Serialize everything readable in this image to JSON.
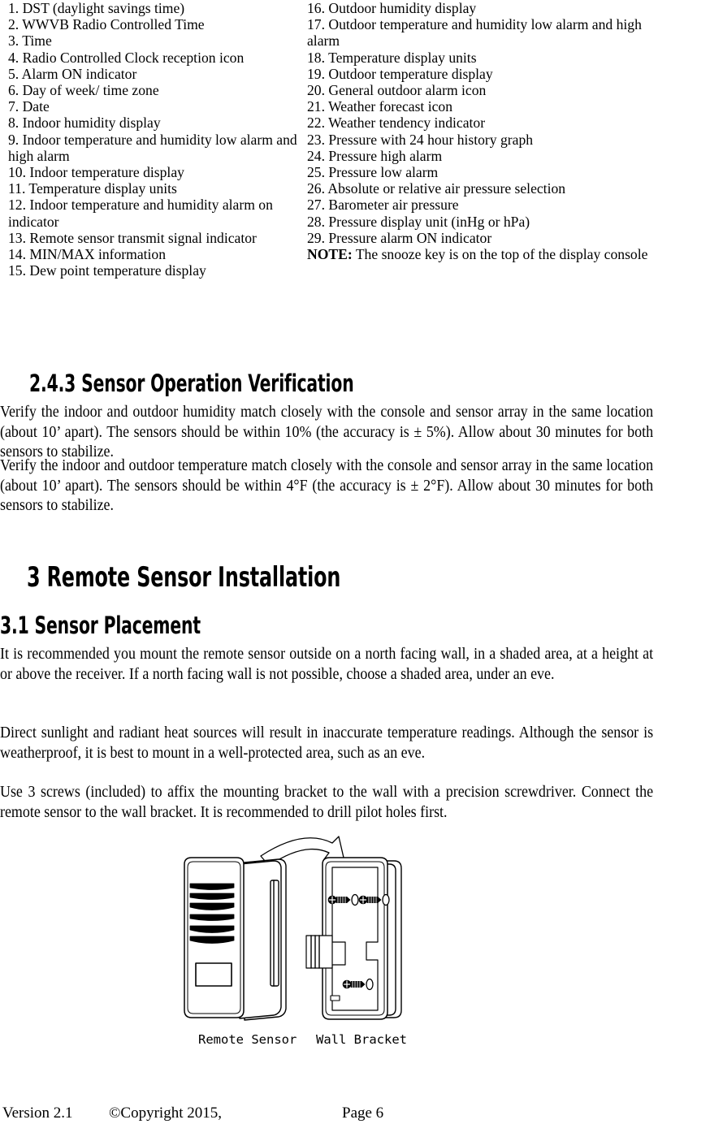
{
  "legend": {
    "left_items": [
      "1. DST (daylight savings time)",
      "2. WWVB Radio Controlled Time",
      "3. Time",
      "4. Radio Controlled Clock reception icon",
      "5. Alarm ON indicator",
      "6. Day of week/ time zone",
      "7. Date",
      "8. Indoor humidity display",
      "9. Indoor temperature and humidity low alarm and high alarm",
      "10. Indoor temperature display",
      "11. Temperature display units",
      "12. Indoor temperature and humidity alarm on indicator",
      "13. Remote sensor transmit signal indicator",
      "14. MIN/MAX information",
      "15. Dew point temperature display"
    ],
    "right_items": [
      "16. Outdoor humidity display",
      "17. Outdoor temperature and humidity low alarm and high alarm",
      "18. Temperature display units",
      "19. Outdoor temperature display",
      "20. General outdoor alarm icon",
      "21. Weather forecast icon",
      "22. Weather tendency indicator",
      "23. Pressure with 24 hour history graph",
      "24. Pressure high alarm",
      "25. Pressure low alarm",
      "26. Absolute or relative air pressure selection",
      "27. Barometer air pressure",
      "28. Pressure display unit (inHg or hPa)",
      "29. Pressure alarm ON indicator"
    ],
    "note_label": "NOTE:",
    "note_text": " The snooze key is on the top of the display console"
  },
  "headings": {
    "section_2_4_3": "2.4.3  Sensor Operation Verification",
    "section_3": "3  Remote Sensor Installation",
    "section_3_1": "3.1   Sensor Placement"
  },
  "paragraphs": {
    "humidity_verify": "Verify the indoor and outdoor humidity match closely with the console and sensor array in the same location (about 10’ apart). The sensors should be within 10% (the accuracy is ± 5%).    Allow about 30 minutes for both sensors to stabilize.",
    "temperature_verify": "Verify the indoor and outdoor temperature match closely with the console and sensor array in the same location (about 10’ apart). The sensors should be within 4°F (the accuracy is ± 2°F).    Allow about 30 minutes for both sensors to stabilize.",
    "placement_1": "It is recommended you mount the remote sensor outside on a north facing wall, in a shaded area, at a height at or above the receiver. If a north facing wall is not possible, choose a shaded area, under an eve.",
    "placement_2": "Direct sunlight and radiant heat sources will result in inaccurate temperature readings. Although the sensor is weatherproof, it is best to mount in a well-protected area, such as an eve.",
    "placement_3": "Use 3 screws (included) to affix the mounting bracket to the wall with a precision screwdriver. Connect the remote sensor to the wall bracket. It is recommended to drill pilot holes first."
  },
  "diagram": {
    "label_sensor": "Remote Sensor",
    "label_bracket": "Wall Bracket",
    "screw_count": 3,
    "vent_slat_count": 6,
    "line_color": "#000000"
  },
  "footer": {
    "version": "Version 2.1",
    "copyright": "©Copyright 2015,",
    "page": "Page 6"
  }
}
